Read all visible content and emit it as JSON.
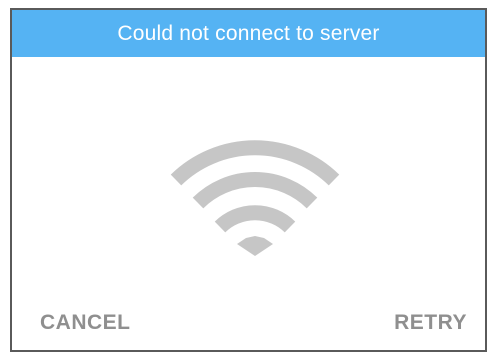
{
  "dialog": {
    "title": "Could not connect to server",
    "icon": "wifi-icon",
    "buttons": {
      "cancel_label": "CANCEL",
      "retry_label": "RETRY"
    }
  },
  "colors": {
    "header_background": "#55b3f3",
    "header_text": "#ffffff",
    "icon": "#c6c6c6",
    "button_text": "#8f8f8f",
    "border": "#5a5a5a"
  }
}
